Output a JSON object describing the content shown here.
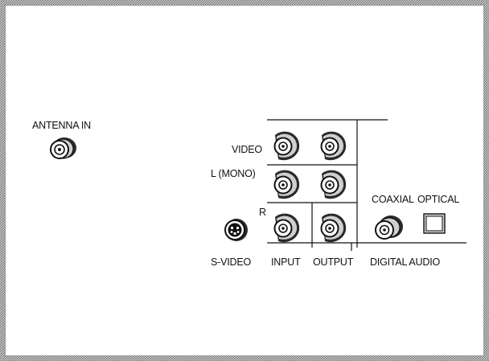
{
  "panel": {
    "antenna_label": "ANTENNA IN",
    "rows": {
      "video": "VIDEO",
      "left_mono": "L (MONO)",
      "right": "R"
    },
    "columns": {
      "input": "INPUT",
      "output": "OUTPUT"
    },
    "svideo_label": "S-VIDEO",
    "digital_audio": {
      "coaxial": "COAXIAL",
      "optical": "OPTICAL",
      "group_label": "DIGITAL AUDIO"
    }
  },
  "colors": {
    "background": "#ffffff",
    "frame_hatch": "#9a9a9a",
    "ink": "#111111"
  },
  "icons": [
    "coax-connector-icon",
    "rca-jack-icon",
    "svideo-jack-icon",
    "optical-port-icon"
  ]
}
